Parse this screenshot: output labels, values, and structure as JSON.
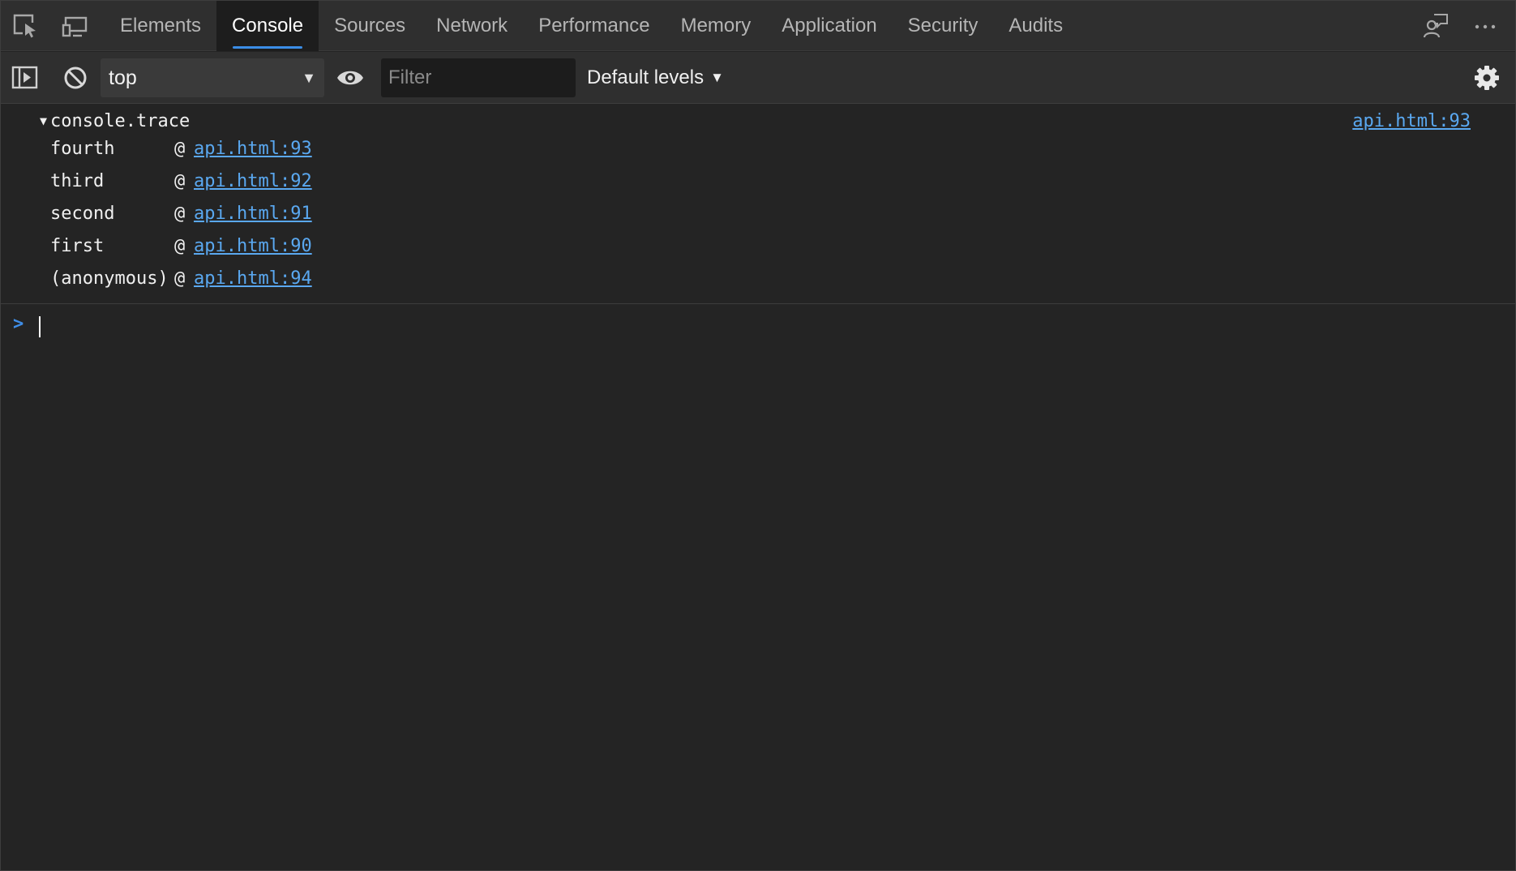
{
  "tabbar": {
    "tabs": [
      "Elements",
      "Console",
      "Sources",
      "Network",
      "Performance",
      "Memory",
      "Application",
      "Security",
      "Audits"
    ],
    "active_tab": "Console"
  },
  "toolbar": {
    "context_value": "top",
    "filter_placeholder": "Filter",
    "filter_value": "",
    "levels_label": "Default levels"
  },
  "console": {
    "trace_label": "console.trace",
    "trace_source": "api.html:93",
    "frames": [
      {
        "fn": "fourth",
        "at": "@",
        "src": "api.html:93"
      },
      {
        "fn": "third",
        "at": "@",
        "src": "api.html:92"
      },
      {
        "fn": "second",
        "at": "@",
        "src": "api.html:91"
      },
      {
        "fn": "first",
        "at": "@",
        "src": "api.html:90"
      },
      {
        "fn": "(anonymous)",
        "at": "@",
        "src": "api.html:94"
      }
    ]
  },
  "icons": {
    "inspect": "inspect-element-icon",
    "device": "device-toolbar-icon",
    "feedback": "feedback-icon",
    "more": "more-options-icon",
    "sidebar": "show-sidebar-icon",
    "clear": "clear-console-icon",
    "eye": "live-expression-icon",
    "settings": "gear-icon",
    "prompt": "prompt-chevron-icon"
  },
  "colors": {
    "link": "#5aa8f0",
    "accent": "#3b8de6",
    "background": "#242424",
    "toolbar": "#2f2f2f"
  }
}
